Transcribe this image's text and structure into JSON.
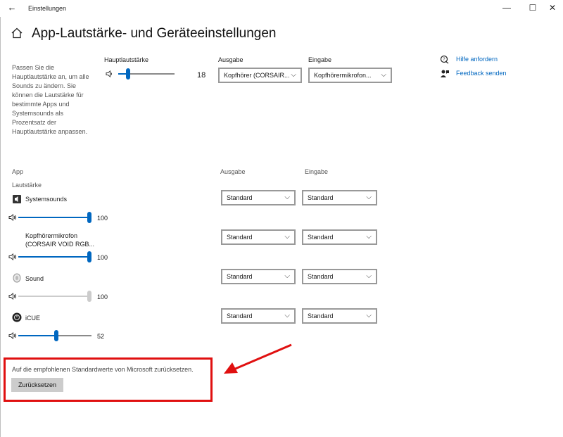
{
  "window": {
    "title": "Einstellungen",
    "back_glyph": "←",
    "minimize_glyph": "—",
    "maximize_glyph": "☐",
    "close_glyph": "✕"
  },
  "page": {
    "title": "App-Lautstärke- und Geräteeinstellungen",
    "description": "Passen Sie die Hauptlautstärke an, um alle Sounds zu ändern. Sie können die Lautstärke für bestimmte Apps und Systemsounds als Prozentsatz der Hauptlautstärke anpassen."
  },
  "master": {
    "label": "Hauptlautstärke",
    "value": "18",
    "level": 0.18,
    "output_label": "Ausgabe",
    "output_value": "Kopfhörer (CORSAIR...",
    "input_label": "Eingabe",
    "input_value": "Kopfhörermikrofon..."
  },
  "links": {
    "help": "Hilfe anfordern",
    "feedback": "Feedback senden"
  },
  "apps_header": {
    "app": "App",
    "volume": "Lautstärke",
    "output": "Ausgabe",
    "input": "Eingabe"
  },
  "apps": [
    {
      "name": "Systemsounds",
      "volume": "100",
      "level": 1.0,
      "output": "Standard",
      "input": "Standard",
      "enabled": true
    },
    {
      "name": "Kopfhörermikrofon (CORSAIR VOID RGB...",
      "volume": "100",
      "level": 1.0,
      "output": "Standard",
      "input": "Standard",
      "enabled": true
    },
    {
      "name": "Sound",
      "volume": "100",
      "level": 1.0,
      "output": "Standard",
      "input": "Standard",
      "enabled": false
    },
    {
      "name": "iCUE",
      "volume": "52",
      "level": 0.52,
      "output": "Standard",
      "input": "Standard",
      "enabled": true
    }
  ],
  "reset": {
    "text": "Auf die empfohlenen Standardwerte von Microsoft zurücksetzen.",
    "button": "Zurücksetzen"
  },
  "colors": {
    "accent": "#0067c0",
    "annotation_red": "#e01010"
  }
}
